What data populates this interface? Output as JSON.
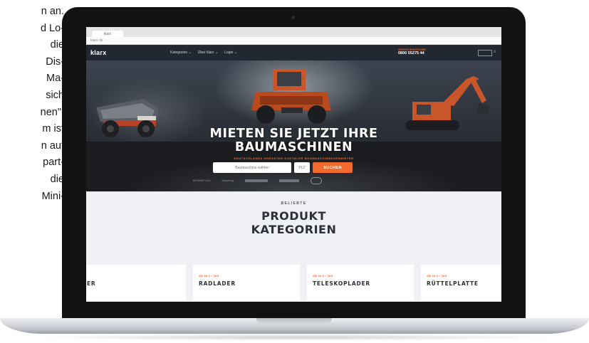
{
  "article": {
    "lines": [
      "n an.",
      "d Lo-",
      "die",
      "Dis-",
      "Ma-",
      "sich",
      "nen\",",
      "m ist",
      "n auf",
      "part-",
      "die",
      "Mini-"
    ]
  },
  "browser": {
    "tab_label": "klarx",
    "address": "klarx.de"
  },
  "site": {
    "logo": "klarx",
    "nav": [
      "Kategorien ⌄",
      "Über klarx ⌄",
      "Login ⌄"
    ],
    "hotline_label": "SERVICEHOTLINE",
    "hotline_number": "0800 55275 44"
  },
  "hero": {
    "title_line1": "MIETEN SIE JETZT IHRE",
    "title_line2": "BAUMASCHINEN",
    "subtitle": "DEUTSCHLANDS GRÖSSTER DIGITALER BAUMASCHINENVERMIETER",
    "machine_placeholder": "Baumaschine wählen",
    "plz_placeholder": "PLZ",
    "search_label": "SUCHEN",
    "press": [
      "BEKANNT AUS",
      "Bloomberg"
    ]
  },
  "categories": {
    "kicker": "BELIEBTE",
    "title_line1": "PRODUKT",
    "title_line2": "KATEGORIEN",
    "cards": [
      {
        "price": "",
        "name": "GER"
      },
      {
        "price": "AB 88 € / TAG",
        "name": "RADLADER"
      },
      {
        "price": "AB 39 € / TAG",
        "name": "TELESKOPLADER"
      },
      {
        "price": "AB 35 € / TAG",
        "name": "RÜTTELPLATTE"
      }
    ]
  },
  "colors": {
    "accent": "#f26a2e",
    "header_bg": "#222831",
    "text_dark": "#2b3038"
  }
}
